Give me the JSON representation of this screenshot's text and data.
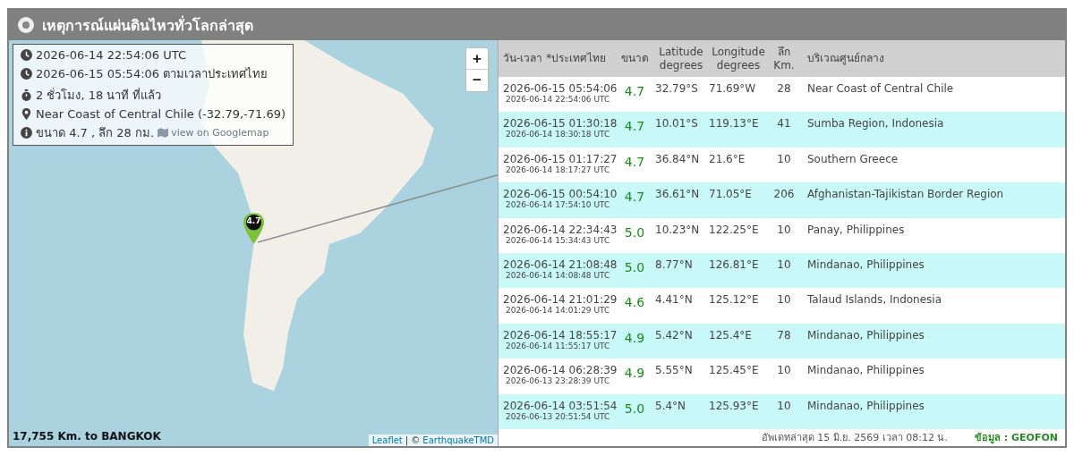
{
  "header": {
    "title": "เหตุการณ์แผ่นดินไหวทั่วโลกล่าสุด"
  },
  "map": {
    "zoom_controls": [
      "+",
      "−"
    ],
    "info": [
      {
        "kind": "clock",
        "text": "2026-06-14 22:54:06 UTC"
      },
      {
        "kind": "clock",
        "text": "2026-06-15 05:54:06 ตามเวลาประเทศไทย"
      },
      {
        "kind": "stopwatch",
        "text": "2 ชั่วโมง, 18 นาที ที่แล้ว"
      },
      {
        "kind": "pin",
        "text": "Near Coast of Central Chile (-32.79,-71.69)"
      },
      {
        "kind": "info",
        "text": "ขนาด 4.7 , ลึก 28 กม.",
        "link": "view on Googlemap"
      }
    ],
    "marker": "4.7",
    "distance": "17,755 Km. to BANGKOK",
    "attribution": {
      "leaflet": "Leaflet",
      "separator": "| ©",
      "source": "EarthquakeTMD"
    }
  },
  "table": {
    "columns": [
      [
        "วัน-เวลา *ประเทศไทย"
      ],
      [
        "ขนาด"
      ],
      [
        "Latitude",
        "degrees"
      ],
      [
        "Longitude",
        "degrees"
      ],
      [
        "ลึก",
        "Km."
      ],
      [
        "บริเวณศูนย์กลาง"
      ]
    ],
    "rows": [
      {
        "time_local": "2026-06-15 05:54:06",
        "time_utc": "2026-06-14 22:54:06 UTC",
        "magnitude": "4.7",
        "latitude": "32.79°S",
        "longitude": "71.69°W",
        "depth": "28",
        "region": "Near Coast of Central Chile"
      },
      {
        "time_local": "2026-06-15 01:30:18",
        "time_utc": "2026-06-14 18:30:18 UTC",
        "magnitude": "4.7",
        "latitude": "10.01°S",
        "longitude": "119.13°E",
        "depth": "41",
        "region": "Sumba Region, Indonesia"
      },
      {
        "time_local": "2026-06-15 01:17:27",
        "time_utc": "2026-06-14 18:17:27 UTC",
        "magnitude": "4.7",
        "latitude": "36.84°N",
        "longitude": "21.6°E",
        "depth": "10",
        "region": "Southern Greece"
      },
      {
        "time_local": "2026-06-15 00:54:10",
        "time_utc": "2026-06-14 17:54:10 UTC",
        "magnitude": "4.7",
        "latitude": "36.61°N",
        "longitude": "71.05°E",
        "depth": "206",
        "region": "Afghanistan-Tajikistan Border Region"
      },
      {
        "time_local": "2026-06-14 22:34:43",
        "time_utc": "2026-06-14 15:34:43 UTC",
        "magnitude": "5.0",
        "latitude": "10.23°N",
        "longitude": "122.25°E",
        "depth": "10",
        "region": "Panay, Philippines"
      },
      {
        "time_local": "2026-06-14 21:08:48",
        "time_utc": "2026-06-14 14:08:48 UTC",
        "magnitude": "5.0",
        "latitude": "8.77°N",
        "longitude": "126.81°E",
        "depth": "10",
        "region": "Mindanao, Philippines"
      },
      {
        "time_local": "2026-06-14 21:01:29",
        "time_utc": "2026-06-14 14:01:29 UTC",
        "magnitude": "4.6",
        "latitude": "4.41°N",
        "longitude": "125.12°E",
        "depth": "10",
        "region": "Talaud Islands, Indonesia"
      },
      {
        "time_local": "2026-06-14 18:55:17",
        "time_utc": "2026-06-14 11:55:17 UTC",
        "magnitude": "4.9",
        "latitude": "5.42°N",
        "longitude": "125.4°E",
        "depth": "78",
        "region": "Mindanao, Philippines"
      },
      {
        "time_local": "2026-06-14 06:28:39",
        "time_utc": "2026-06-13 23:28:39 UTC",
        "magnitude": "4.9",
        "latitude": "5.55°N",
        "longitude": "125.45°E",
        "depth": "10",
        "region": "Mindanao, Philippines"
      },
      {
        "time_local": "2026-06-14 03:51:54",
        "time_utc": "2026-06-13 20:51:54 UTC",
        "magnitude": "5.0",
        "latitude": "5.4°N",
        "longitude": "125.93°E",
        "depth": "10",
        "region": "Mindanao, Philippines"
      }
    ],
    "updated": "อัพเดทล่าสุด 15 มิ.ย. 2569 เวลา 08:12 น.",
    "source": "ข้อมูล : GEOFON"
  }
}
